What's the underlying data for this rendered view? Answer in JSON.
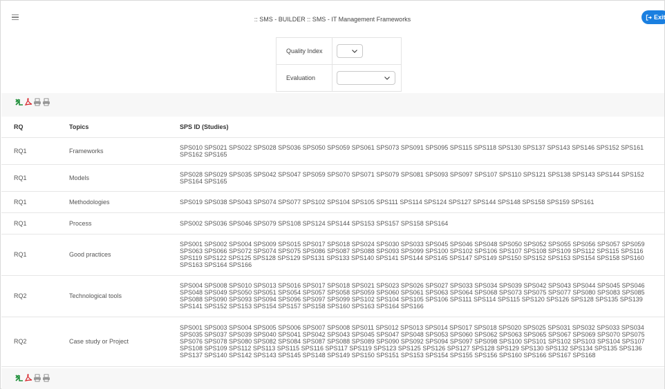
{
  "header": {
    "title": ":: SMS - BUILDER :: SMS - IT Management Frameworks",
    "exit_label": "Exit"
  },
  "filters": {
    "quality_label": "Quality Index",
    "quality_value": "",
    "evaluation_label": "Evaluation",
    "evaluation_value": ""
  },
  "table": {
    "columns": [
      "RQ",
      "Topics",
      "SPS ID (Studies)"
    ],
    "rows": [
      {
        "rq": "RQ1",
        "topic": "Frameworks",
        "ids": "SPS010 SPS021 SPS022 SPS028 SPS036 SPS050 SPS059 SPS061 SPS073 SPS091 SPS095 SPS115 SPS118 SPS130 SPS137 SPS143 SPS146 SPS152 SPS161 SPS162 SPS165"
      },
      {
        "rq": "RQ1",
        "topic": "Models",
        "ids": "SPS028 SPS029 SPS035 SPS042 SPS047 SPS059 SPS070 SPS071 SPS079 SPS081 SPS093 SPS097 SPS107 SPS110 SPS121 SPS138 SPS143 SPS144 SPS152 SPS164 SPS165"
      },
      {
        "rq": "RQ1",
        "topic": "Methodologies",
        "ids": "SPS019 SPS038 SPS043 SPS074 SPS077 SPS102 SPS104 SPS105 SPS111 SPS114 SPS124 SPS127 SPS144 SPS148 SPS158 SPS159 SPS161"
      },
      {
        "rq": "RQ1",
        "topic": "Process",
        "ids": "SPS002 SPS036 SPS046 SPS079 SPS108 SPS124 SPS144 SPS153 SPS157 SPS158 SPS164"
      },
      {
        "rq": "RQ1",
        "topic": "Good practices",
        "ids": "SPS001 SPS002 SPS004 SPS009 SPS015 SPS017 SPS018 SPS024 SPS030 SPS033 SPS045 SPS046 SPS048 SPS050 SPS052 SPS055 SPS056 SPS057 SPS059 SPS063 SPS066 SPS072 SPS074 SPS075 SPS086 SPS087 SPS088 SPS093 SPS099 SPS100 SPS102 SPS106 SPS107 SPS108 SPS109 SPS112 SPS115 SPS116 SPS119 SPS122 SPS125 SPS128 SPS129 SPS131 SPS133 SPS140 SPS141 SPS144 SPS145 SPS147 SPS149 SPS150 SPS152 SPS153 SPS154 SPS158 SPS160 SPS163 SPS164 SPS166"
      },
      {
        "rq": "RQ2",
        "topic": "Technological tools",
        "ids": "SPS004 SPS008 SPS010 SPS013 SPS016 SPS017 SPS018 SPS021 SPS023 SPS026 SPS027 SPS033 SPS034 SPS039 SPS042 SPS043 SPS044 SPS045 SPS046 SPS048 SPS049 SPS050 SPS051 SPS054 SPS057 SPS058 SPS059 SPS060 SPS061 SPS063 SPS064 SPS068 SPS073 SPS075 SPS077 SPS080 SPS083 SPS085 SPS088 SPS090 SPS093 SPS094 SPS096 SPS097 SPS099 SPS102 SPS104 SPS105 SPS106 SPS111 SPS114 SPS115 SPS120 SPS126 SPS128 SPS135 SPS139 SPS141 SPS152 SPS153 SPS154 SPS157 SPS158 SPS160 SPS163 SPS164 SPS166"
      },
      {
        "rq": "RQ2",
        "topic": "Case study or Project",
        "ids": "SPS001 SPS003 SPS004 SPS005 SPS006 SPS007 SPS008 SPS011 SPS012 SPS013 SPS014 SPS017 SPS018 SPS020 SPS025 SPS031 SPS032 SPS033 SPS034 SPS035 SPS037 SPS039 SPS040 SPS041 SPS042 SPS043 SPS045 SPS047 SPS048 SPS053 SPS060 SPS062 SPS063 SPS065 SPS067 SPS069 SPS070 SPS075 SPS076 SPS078 SPS080 SPS082 SPS084 SPS087 SPS088 SPS089 SPS090 SPS092 SPS094 SPS097 SPS098 SPS100 SPS101 SPS102 SPS103 SPS104 SPS107 SPS108 SPS109 SPS112 SPS113 SPS115 SPS116 SPS117 SPS119 SPS123 SPS125 SPS126 SPS127 SPS128 SPS129 SPS130 SPS132 SPS134 SPS135 SPS136 SPS137 SPS140 SPS142 SPS143 SPS145 SPS148 SPS149 SPS150 SPS151 SPS153 SPS154 SPS155 SPS156 SPS160 SPS166 SPS167 SPS168"
      }
    ]
  },
  "toolbar_icons": [
    "excel-icon",
    "pdf-icon",
    "print-icon",
    "print-icon"
  ],
  "colors": {
    "exit_button": "#1a7fe0",
    "excel": "#1f8f3a",
    "pdf": "#d8262c",
    "band": "#f7f7f7"
  }
}
